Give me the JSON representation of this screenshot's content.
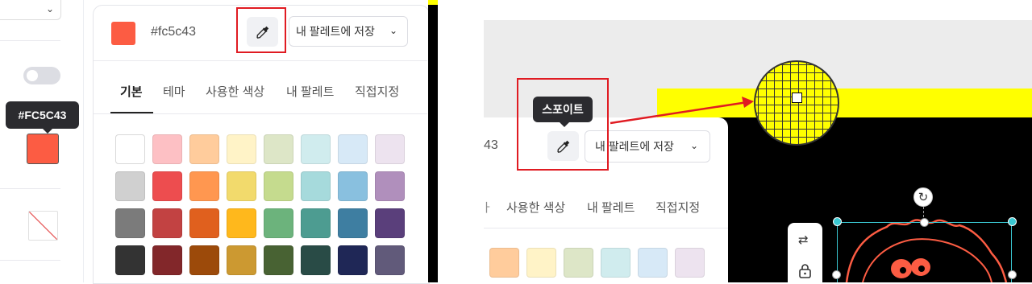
{
  "left": {
    "tooltip_hex": "#FC5C43",
    "swatch_color": "#fc5c43"
  },
  "picker": {
    "current_color": "#fc5c43",
    "hex_value": "#fc5c43",
    "save_label": "내 팔레트에 저장",
    "tabs": [
      "기본",
      "테마",
      "사용한 색상",
      "내 팔레트",
      "직접지정"
    ],
    "active_tab": "기본",
    "palette_rows": [
      [
        "#ffffff",
        "#fdc0c4",
        "#ffcc9c",
        "#fff3c7",
        "#dde6c7",
        "#d0ecee",
        "#d7e9f7",
        "#ede3ef"
      ],
      [
        "#d0d0d0",
        "#ed4d4f",
        "#ff9750",
        "#f2da6c",
        "#c5db8e",
        "#a6dadc",
        "#89c0df",
        "#b08fbc"
      ],
      [
        "#7b7b7b",
        "#c24242",
        "#e0601e",
        "#ffb81c",
        "#6cb37c",
        "#4d9c91",
        "#3e7ea1",
        "#5a3f7b"
      ],
      [
        "#333333",
        "#82272a",
        "#9c4a0a",
        "#cc9931",
        "#486233",
        "#294b46",
        "#1f2756",
        "#615a7a"
      ]
    ]
  },
  "right": {
    "hex_partial": "43",
    "tooltip_label": "스포이트",
    "save_label": "내 팔레트에 저장",
    "tabs_partial": [
      "ㅏ",
      "사용한 색상",
      "내 팔레트",
      "직접지정"
    ],
    "palette_partial": [
      "#ffcc9c",
      "#fff3c7",
      "#dde6c7",
      "#d0ecee",
      "#d7e9f7",
      "#ede3ef"
    ]
  },
  "colors": {
    "accent_red_box": "#e01b22",
    "selection": "#3ac8d2",
    "yellow": "#ffff00"
  }
}
